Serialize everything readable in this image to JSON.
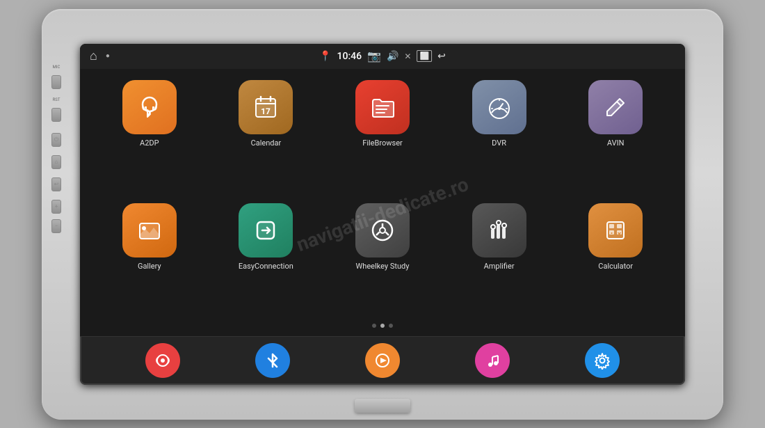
{
  "device": {
    "brand_watermark": "navigatii-dedicate.ro"
  },
  "status_bar": {
    "location_icon": "📍",
    "time": "10:46",
    "camera_icon": "📷",
    "volume_icon": "🔊",
    "close_icon": "✕",
    "screen_icon": "⬜",
    "back_icon": "↩",
    "home_icon": "⌂",
    "dot_icon": "•"
  },
  "apps": [
    {
      "id": "a2dp",
      "label": "A2DP",
      "color": "icon-orange",
      "icon": "a2dp"
    },
    {
      "id": "calendar",
      "label": "Calendar",
      "color": "icon-brown",
      "icon": "calendar"
    },
    {
      "id": "filebrowser",
      "label": "FileBrowser",
      "color": "icon-red-orange",
      "icon": "folder"
    },
    {
      "id": "dvr",
      "label": "DVR",
      "color": "icon-gray",
      "icon": "dvr"
    },
    {
      "id": "avin",
      "label": "AVIN",
      "color": "icon-mauve",
      "icon": "avin"
    },
    {
      "id": "gallery",
      "label": "Gallery",
      "color": "icon-orange2",
      "icon": "gallery"
    },
    {
      "id": "easyconnection",
      "label": "EasyConnection",
      "color": "icon-teal",
      "icon": "easyconn"
    },
    {
      "id": "wheelkey",
      "label": "Wheelkey Study",
      "color": "icon-dark-gray",
      "icon": "wheel"
    },
    {
      "id": "amplifier",
      "label": "Amplifier",
      "color": "icon-dark2",
      "icon": "amplifier"
    },
    {
      "id": "calculator",
      "label": "Calculator",
      "color": "icon-orange3",
      "icon": "calculator"
    }
  ],
  "dock": [
    {
      "id": "radio",
      "color": "dock-red",
      "icon": "radio"
    },
    {
      "id": "bluetooth",
      "color": "dock-blue",
      "icon": "bluetooth"
    },
    {
      "id": "video",
      "color": "dock-orange",
      "icon": "video"
    },
    {
      "id": "music",
      "color": "dock-pink",
      "icon": "music"
    },
    {
      "id": "settings",
      "color": "dock-blue2",
      "icon": "settings"
    }
  ],
  "page_dots": [
    {
      "active": false
    },
    {
      "active": true
    },
    {
      "active": false
    }
  ],
  "side_labels": {
    "mic": "MIC",
    "rst": "RST"
  }
}
